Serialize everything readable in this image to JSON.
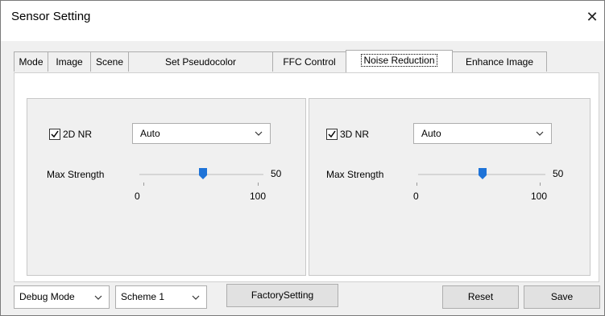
{
  "window": {
    "title": "Sensor Setting",
    "close_glyph": "✕"
  },
  "tabs": [
    {
      "label": "Mode"
    },
    {
      "label": "Image"
    },
    {
      "label": "Scene"
    },
    {
      "label": "Set Pseudocolor"
    },
    {
      "label": "FFC Control"
    },
    {
      "label": "Noise Reduction",
      "active": true
    },
    {
      "label": "Enhance Image"
    }
  ],
  "nr2d": {
    "checkbox_label": "2D NR",
    "checked": true,
    "mode_value": "Auto",
    "strength_label": "Max Strength",
    "strength_value": "50",
    "slider_min": "0",
    "slider_max": "100"
  },
  "nr3d": {
    "checkbox_label": "3D NR",
    "checked": true,
    "mode_value": "Auto",
    "strength_label": "Max Strength",
    "strength_value": "50",
    "slider_min": "0",
    "slider_max": "100"
  },
  "footer": {
    "debug_mode_value": "Debug Mode",
    "scheme_value": "Scheme 1",
    "factory_label": "FactorySetting",
    "reset_label": "Reset",
    "save_label": "Save"
  },
  "colors": {
    "accent": "#1e73d8",
    "panel_bg": "#f0f0f0",
    "button_bg": "#e1e1e1"
  }
}
